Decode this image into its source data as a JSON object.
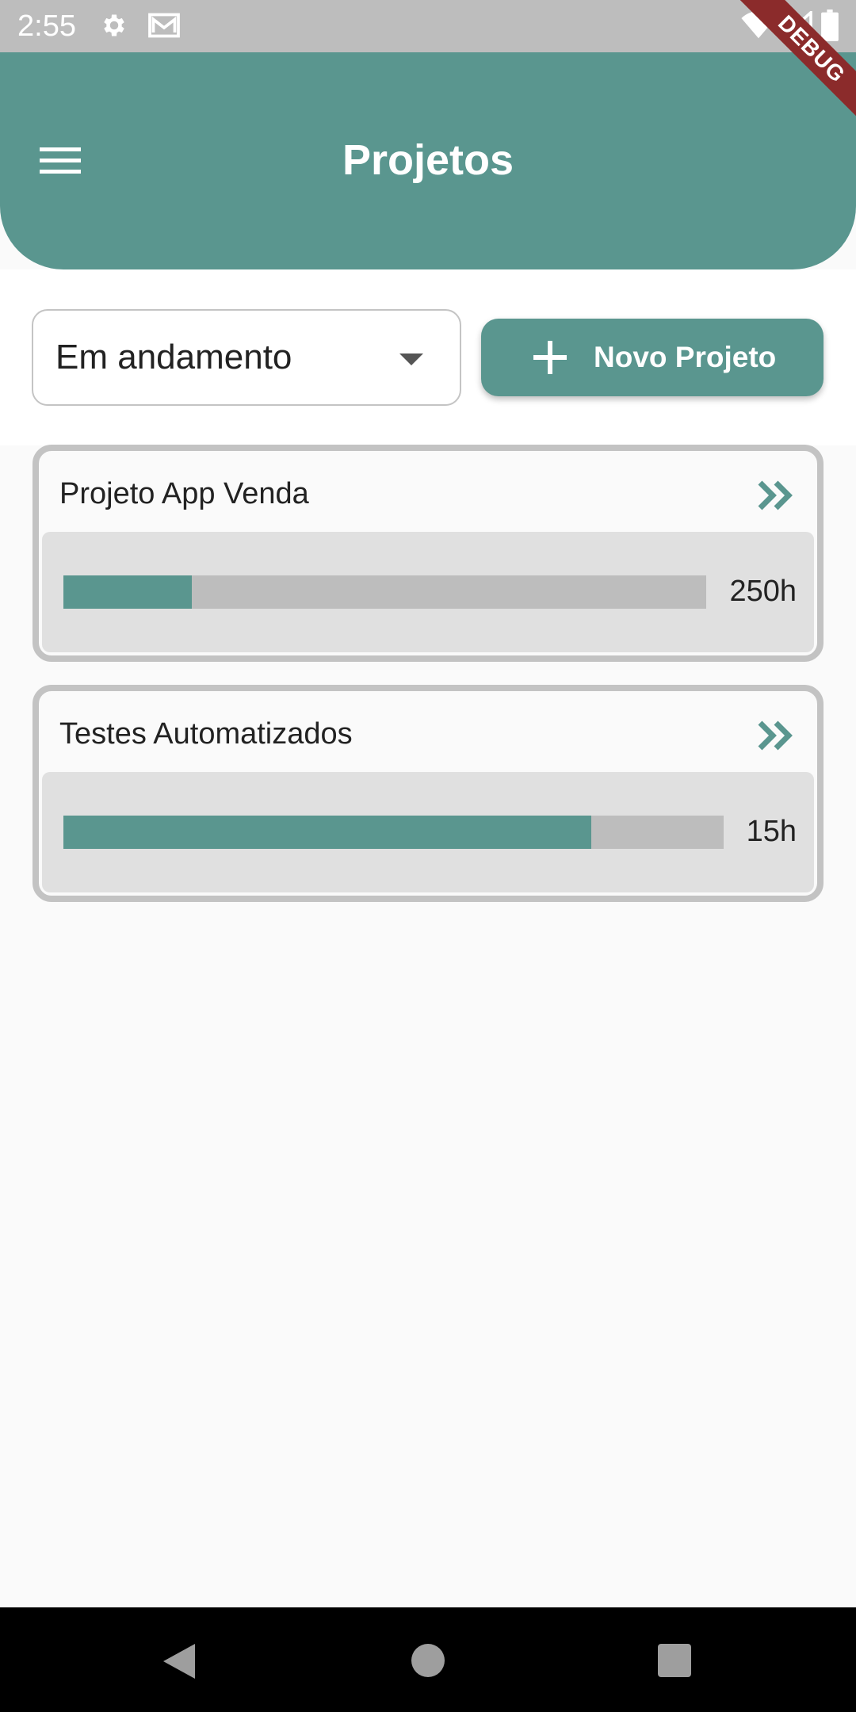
{
  "status_bar": {
    "time": "2:55",
    "icons": [
      "gear-icon",
      "mail-icon",
      "wifi-icon",
      "signal-icon",
      "battery-icon"
    ]
  },
  "debug_banner": {
    "label": "DEBUG"
  },
  "app_bar": {
    "title": "Projetos",
    "menu_icon": "menu-icon"
  },
  "filter": {
    "selected_status": "Em andamento",
    "new_project_label": "Novo Projeto"
  },
  "projects": [
    {
      "name": "Projeto App Venda",
      "hours": "250h",
      "progress": 0.2
    },
    {
      "name": "Testes Automatizados",
      "hours": "15h",
      "progress": 0.8
    }
  ],
  "colors": {
    "accent": "#5a968f",
    "track": "#bdbdbd",
    "card_border": "#c3c3c3",
    "debug": "#8b2b2b"
  }
}
